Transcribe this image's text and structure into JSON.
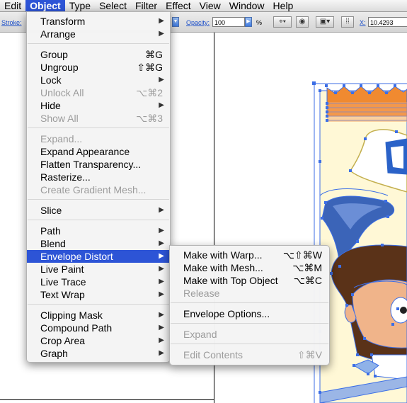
{
  "menubar": {
    "items": [
      {
        "label": "Edit",
        "active": false
      },
      {
        "label": "Object",
        "active": true
      },
      {
        "label": "Type",
        "active": false
      },
      {
        "label": "Select",
        "active": false
      },
      {
        "label": "Filter",
        "active": false
      },
      {
        "label": "Effect",
        "active": false
      },
      {
        "label": "View",
        "active": false
      },
      {
        "label": "Window",
        "active": false
      },
      {
        "label": "Help",
        "active": false
      }
    ]
  },
  "controlbar": {
    "stroke_label": "Stroke:",
    "opacity_label": "Opacity:",
    "opacity_value": "100",
    "percent": "%",
    "x_label": "X:",
    "x_value": "10.4293"
  },
  "object_menu": {
    "items": [
      {
        "label": "Transform",
        "shortcut": "",
        "submenu": true,
        "disabled": false
      },
      {
        "label": "Arrange",
        "shortcut": "",
        "submenu": true,
        "disabled": false
      },
      {
        "label": "Group",
        "shortcut": "⌘G",
        "submenu": false,
        "disabled": false
      },
      {
        "label": "Ungroup",
        "shortcut": "⇧⌘G",
        "submenu": false,
        "disabled": false
      },
      {
        "label": "Lock",
        "shortcut": "",
        "submenu": true,
        "disabled": false
      },
      {
        "label": "Unlock All",
        "shortcut": "⌥⌘2",
        "submenu": false,
        "disabled": true
      },
      {
        "label": "Hide",
        "shortcut": "",
        "submenu": true,
        "disabled": false
      },
      {
        "label": "Show All",
        "shortcut": "⌥⌘3",
        "submenu": false,
        "disabled": true
      },
      {
        "label": "Expand...",
        "shortcut": "",
        "submenu": false,
        "disabled": true
      },
      {
        "label": "Expand Appearance",
        "shortcut": "",
        "submenu": false,
        "disabled": false
      },
      {
        "label": "Flatten Transparency...",
        "shortcut": "",
        "submenu": false,
        "disabled": false
      },
      {
        "label": "Rasterize...",
        "shortcut": "",
        "submenu": false,
        "disabled": false
      },
      {
        "label": "Create Gradient Mesh...",
        "shortcut": "",
        "submenu": false,
        "disabled": true
      },
      {
        "label": "Slice",
        "shortcut": "",
        "submenu": true,
        "disabled": false
      },
      {
        "label": "Path",
        "shortcut": "",
        "submenu": true,
        "disabled": false
      },
      {
        "label": "Blend",
        "shortcut": "",
        "submenu": true,
        "disabled": false
      },
      {
        "label": "Envelope Distort",
        "shortcut": "",
        "submenu": true,
        "disabled": false,
        "highlighted": true
      },
      {
        "label": "Live Paint",
        "shortcut": "",
        "submenu": true,
        "disabled": false
      },
      {
        "label": "Live Trace",
        "shortcut": "",
        "submenu": true,
        "disabled": false
      },
      {
        "label": "Text Wrap",
        "shortcut": "",
        "submenu": true,
        "disabled": false
      },
      {
        "label": "Clipping Mask",
        "shortcut": "",
        "submenu": true,
        "disabled": false
      },
      {
        "label": "Compound Path",
        "shortcut": "",
        "submenu": true,
        "disabled": false
      },
      {
        "label": "Crop Area",
        "shortcut": "",
        "submenu": true,
        "disabled": false
      },
      {
        "label": "Graph",
        "shortcut": "",
        "submenu": true,
        "disabled": false
      }
    ]
  },
  "envelope_submenu": {
    "items": [
      {
        "label": "Make with Warp...",
        "shortcut": "⌥⇧⌘W",
        "disabled": false
      },
      {
        "label": "Make with Mesh...",
        "shortcut": "⌥⌘M",
        "disabled": false
      },
      {
        "label": "Make with Top Object",
        "shortcut": "⌥⌘C",
        "disabled": false
      },
      {
        "label": "Release",
        "shortcut": "",
        "disabled": true
      },
      {
        "label": "Envelope Options...",
        "shortcut": "",
        "disabled": false
      },
      {
        "label": "Expand",
        "shortcut": "",
        "disabled": true
      },
      {
        "label": "Edit Contents",
        "shortcut": "⇧⌘V",
        "disabled": true
      }
    ]
  },
  "colors": {
    "highlight": "#2d54d6",
    "selection": "#3c6ee6",
    "crown_orange": "#f08a30",
    "hair_brown": "#5a3218",
    "skin": "#f0b48a",
    "background_cream": "#fff8d6"
  }
}
